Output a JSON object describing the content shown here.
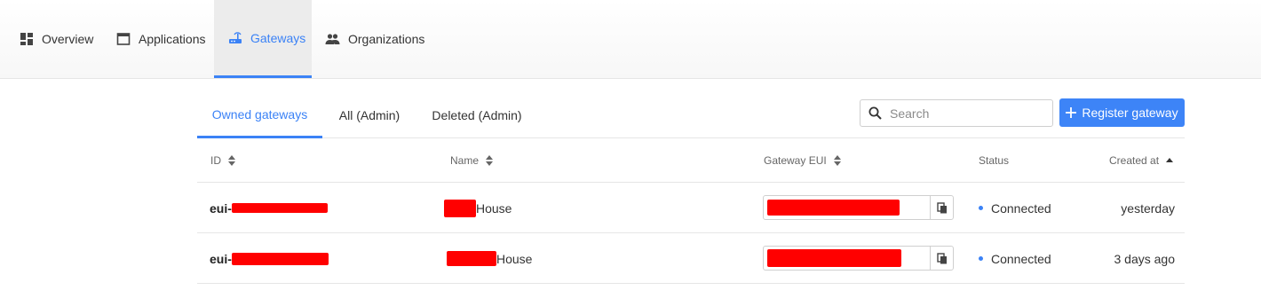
{
  "nav": {
    "items": [
      {
        "label": "Overview",
        "icon": "dashboard-icon"
      },
      {
        "label": "Applications",
        "icon": "window-icon"
      },
      {
        "label": "Gateways",
        "icon": "router-icon",
        "active": true
      },
      {
        "label": "Organizations",
        "icon": "people-icon"
      }
    ]
  },
  "tabs": [
    {
      "label": "Owned gateways",
      "active": true
    },
    {
      "label": "All (Admin)"
    },
    {
      "label": "Deleted (Admin)"
    }
  ],
  "search": {
    "placeholder": "Search",
    "value": ""
  },
  "register_button": {
    "label": "Register gateway"
  },
  "table": {
    "headers": {
      "id": "ID",
      "name": "Name",
      "eui": "Gateway EUI",
      "status": "Status",
      "created": "Created at"
    },
    "rows": [
      {
        "id_prefix": "eui-",
        "name_suffix": "House",
        "status": "Connected",
        "created": "yesterday"
      },
      {
        "id_prefix": "eui-",
        "name_suffix": "House",
        "status": "Connected",
        "created": "3 days ago"
      }
    ]
  },
  "colors": {
    "accent": "#3b82f6",
    "button": "#3d84f7",
    "redaction": "#ff0000"
  }
}
